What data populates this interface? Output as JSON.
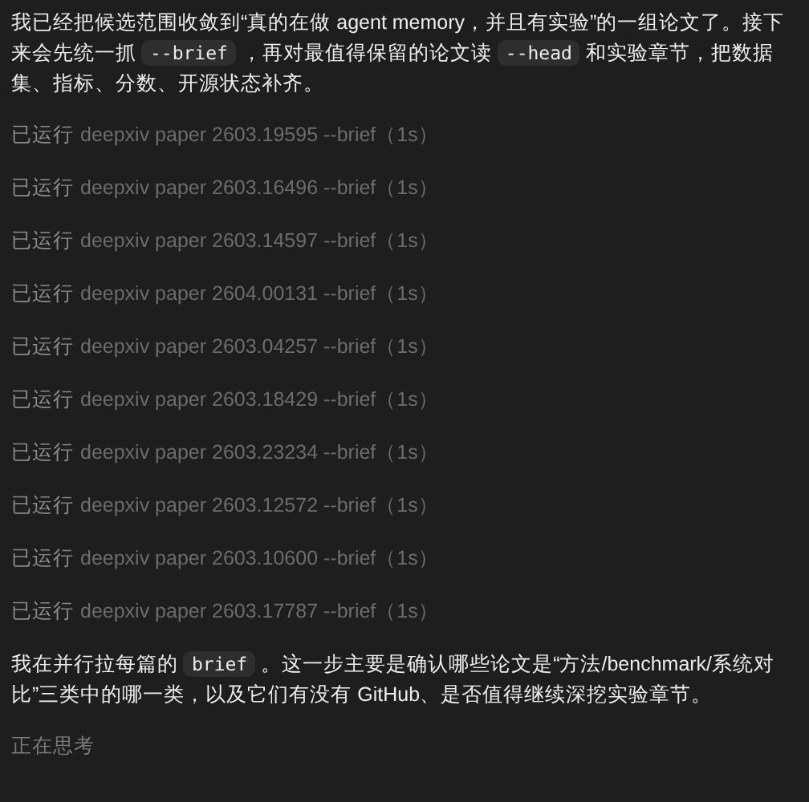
{
  "messages": [
    {
      "kind": "paragraph",
      "segments": [
        {
          "kind": "text",
          "text": "我已经把候选范围收敛到“真的在做 agent memory，并且有实验”的一组论文了。接下来会先统一抓 "
        },
        {
          "kind": "code",
          "text": "--brief"
        },
        {
          "kind": "text",
          "text": " ，再对最值得保留的论文读 "
        },
        {
          "kind": "code",
          "text": "--head"
        },
        {
          "kind": "text",
          "text": " 和实验章节，把数据集、指标、分数、开源状态补齐。"
        }
      ]
    },
    {
      "kind": "run",
      "label": "已运行",
      "command": "deepxiv paper 2603.19595 --brief（1s）"
    },
    {
      "kind": "run",
      "label": "已运行",
      "command": "deepxiv paper 2603.16496 --brief（1s）"
    },
    {
      "kind": "run",
      "label": "已运行",
      "command": "deepxiv paper 2603.14597 --brief（1s）"
    },
    {
      "kind": "run",
      "label": "已运行",
      "command": "deepxiv paper 2604.00131 --brief（1s）"
    },
    {
      "kind": "run",
      "label": "已运行",
      "command": "deepxiv paper 2603.04257 --brief（1s）"
    },
    {
      "kind": "run",
      "label": "已运行",
      "command": "deepxiv paper 2603.18429 --brief（1s）"
    },
    {
      "kind": "run",
      "label": "已运行",
      "command": "deepxiv paper 2603.23234 --brief（1s）"
    },
    {
      "kind": "run",
      "label": "已运行",
      "command": "deepxiv paper 2603.12572 --brief（1s）"
    },
    {
      "kind": "run",
      "label": "已运行",
      "command": "deepxiv paper 2603.10600 --brief（1s）"
    },
    {
      "kind": "run",
      "label": "已运行",
      "command": "deepxiv paper 2603.17787 --brief（1s）"
    },
    {
      "kind": "paragraph",
      "segments": [
        {
          "kind": "text",
          "text": "我在并行拉每篇的 "
        },
        {
          "kind": "code",
          "text": "brief"
        },
        {
          "kind": "text",
          "text": " 。这一步主要是确认哪些论文是“方法/benchmark/系统对比”三类中的哪一类，以及它们有没有 GitHub、是否值得继续深挖实验章节。"
        }
      ]
    },
    {
      "kind": "status",
      "text": "正在思考"
    }
  ]
}
